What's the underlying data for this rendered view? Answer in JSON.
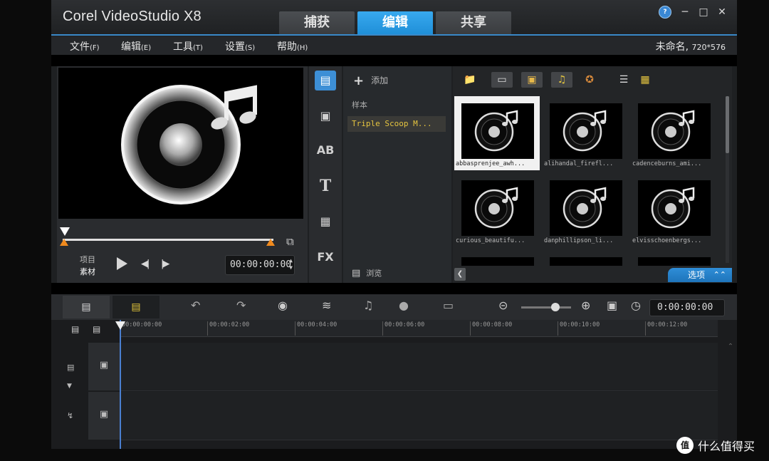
{
  "app": {
    "title": "Corel VideoStudio X8",
    "tabs": [
      "捕获",
      "编辑",
      "共享"
    ],
    "active_tab": "编辑",
    "help_icon": "help-icon"
  },
  "menu": {
    "items": [
      {
        "label": "文件",
        "key": "(F)"
      },
      {
        "label": "编辑",
        "key": "(E)"
      },
      {
        "label": "工具",
        "key": "(T)"
      },
      {
        "label": "设置",
        "key": "(S)"
      },
      {
        "label": "帮助",
        "key": "(H)"
      }
    ],
    "project_name": "未命名,",
    "project_size": "720*576"
  },
  "player": {
    "mode_project": "项目",
    "mode_clip": "素材",
    "timecode": "00:00:00:00"
  },
  "library": {
    "nav_icons": [
      "media-icon",
      "instant-project-icon",
      "transition-icon",
      "title-icon",
      "graphic-icon",
      "filter-icon"
    ],
    "add_label": "添加",
    "folders": [
      "样本",
      "Triple Scoop M..."
    ],
    "browse_label": "浏览",
    "options_label": "选项",
    "thumbnails": [
      "abbasprenjee_awh...",
      "alihandal_firefl...",
      "cadenceburns_ami...",
      "curious_beautifu...",
      "danphillipson_li...",
      "elvisschoenbergs..."
    ]
  },
  "timeline": {
    "timecode": "0:00:00:00",
    "ruler_ticks": [
      "00:00:00:00",
      "00:00:02:00",
      "00:00:04:00",
      "00:00:06:00",
      "00:00:08:00",
      "00:00:10:00",
      "00:00:12:00"
    ]
  },
  "watermark": {
    "logo": "值",
    "text": "什么值得买"
  },
  "colors": {
    "accent": "#1f8fd8",
    "folder_highlight": "#e5c440",
    "trim_marker": "#f08a1d"
  }
}
